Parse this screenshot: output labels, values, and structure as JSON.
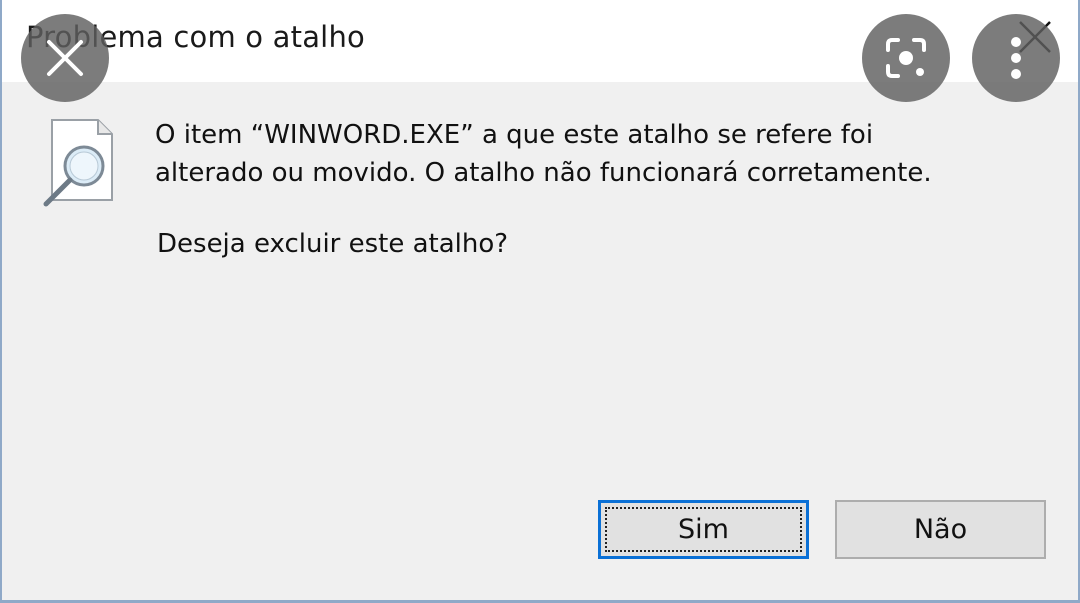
{
  "dialog": {
    "title": "Problema com o atalho",
    "message_line1": "O item “WINWORD.EXE” a que este atalho se refere foi",
    "message_line2": "alterado ou movido. O atalho não funcionará corretamente.",
    "question": "Deseja excluir este atalho?",
    "buttons": {
      "yes_label": "Sim",
      "no_label": "Não"
    }
  },
  "icons": {
    "window_close": "close-icon",
    "file_search": "file-search-icon",
    "overlay_close": "close-icon",
    "overlay_lens": "lens-icon",
    "overlay_more": "more-vertical-icon"
  },
  "colors": {
    "dialog_background": "#f0f0f0",
    "titlebar_background": "#ffffff",
    "default_button_border": "#0a70d6",
    "button_background": "#e1e1e1",
    "overlay_background": "#5f5f5f"
  }
}
